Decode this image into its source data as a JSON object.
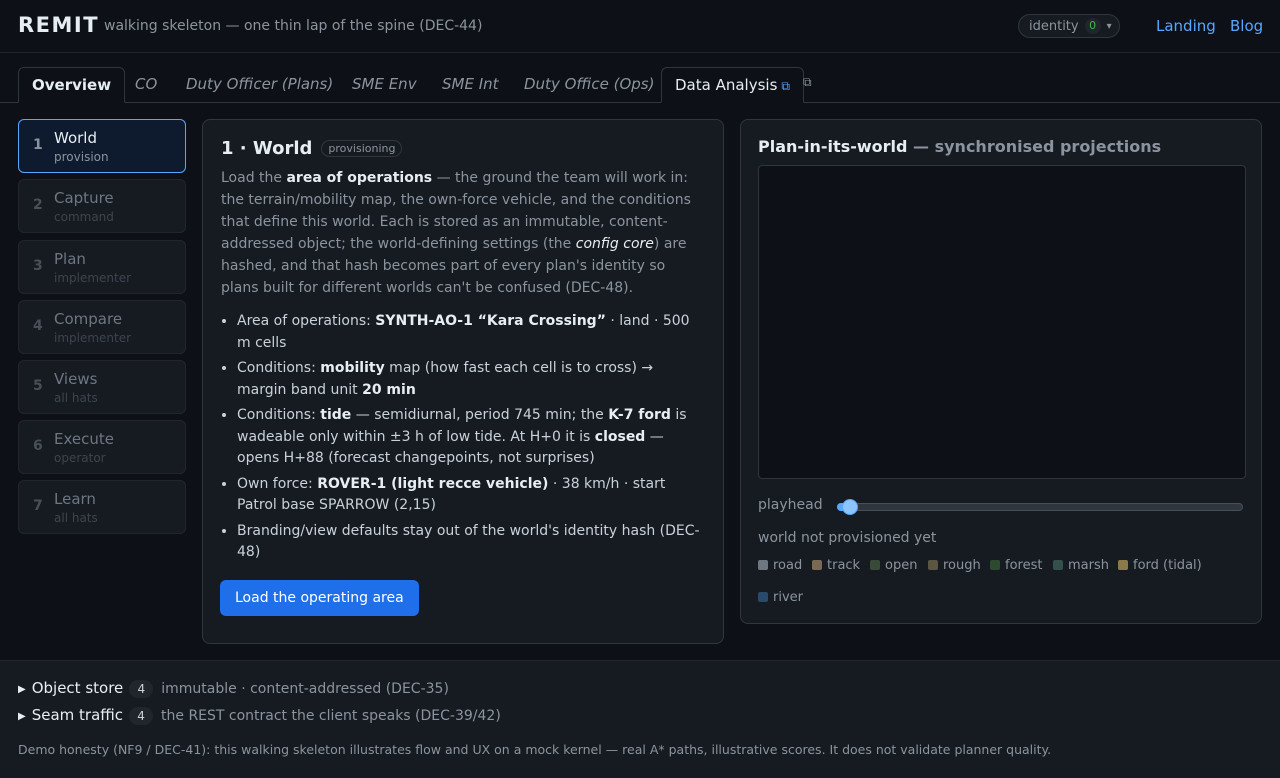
{
  "header": {
    "brand": "REMIT",
    "tagline": "walking skeleton — one thin lap of the spine (DEC-44)",
    "identity_label": "identity",
    "identity_count": "0",
    "links": [
      "Landing",
      "Blog"
    ]
  },
  "tabs": [
    "Overview",
    "CO",
    "Duty Officer (Plans)",
    "SME Env",
    "SME Int",
    "Duty Office (Ops)",
    "Data Analysis"
  ],
  "steps": [
    {
      "num": "1",
      "title": "World",
      "sub": "provision"
    },
    {
      "num": "2",
      "title": "Capture",
      "sub": "command"
    },
    {
      "num": "3",
      "title": "Plan",
      "sub": "implementer"
    },
    {
      "num": "4",
      "title": "Compare",
      "sub": "implementer"
    },
    {
      "num": "5",
      "title": "Views",
      "sub": "all hats"
    },
    {
      "num": "6",
      "title": "Execute",
      "sub": "operator"
    },
    {
      "num": "7",
      "title": "Learn",
      "sub": "all hats"
    }
  ],
  "card": {
    "title": "1 · World",
    "badge": "provisioning",
    "intro": {
      "p1": "Load the ",
      "b1": "area of operations",
      "p2": " — the ground the team will work in: the terrain/mobility map, the own-force vehicle, and the conditions that define this world. Each is stored as an immutable, content-addressed object; the world-defining settings (the ",
      "i1": "config core",
      "p3": ") are hashed, and that hash becomes part of every plan's identity so plans built for different worlds can't be confused (DEC-48)."
    },
    "facts": {
      "f1a": "Area of operations: ",
      "f1b": "SYNTH-AO-1 “Kara Crossing”",
      "f1c": " · land · 500 m cells",
      "f2a": "Conditions: ",
      "f2b": "mobility",
      "f2c": " map (how fast each cell is to cross) → margin band unit ",
      "f2d": "20 min",
      "f3a": "Conditions: ",
      "f3b": "tide",
      "f3c": " — semidiurnal, period 745 min; the ",
      "f3d": "K-7 ford",
      "f3e": " is wadeable only within ±3 h of low tide. At H+0 it is ",
      "f3f": "closed",
      "f3g": " — opens H+88 (forecast changepoints, not surprises)",
      "f4a": "Own force: ",
      "f4b": "ROVER-1 (light recce vehicle)",
      "f4c": " · 38 km/h · start Patrol base SPARROW (2,15)",
      "f5": "Branding/view defaults stay out of the world's identity hash (DEC-48)"
    },
    "button": "Load the operating area"
  },
  "panel": {
    "title": "Plan-in-its-world",
    "subtitle": " — synchronised projections",
    "playhead_label": "playhead",
    "playhead_position": 0.0,
    "status": "world not provisioned yet",
    "legend": [
      {
        "label": "road",
        "color": "#6e7681"
      },
      {
        "label": "track",
        "color": "#7a6a55"
      },
      {
        "label": "open",
        "color": "#3a4a38"
      },
      {
        "label": "rough",
        "color": "#5a5640"
      },
      {
        "label": "forest",
        "color": "#2c4a30"
      },
      {
        "label": "marsh",
        "color": "#34504a"
      },
      {
        "label": "ford (tidal)",
        "color": "#8a7a4a"
      },
      {
        "label": "river",
        "color": "#2a4a6a"
      }
    ]
  },
  "footer": {
    "object_store": {
      "label": "Object store",
      "count": "4",
      "desc": "immutable · content-addressed (DEC-35)"
    },
    "seam_traffic": {
      "label": "Seam traffic",
      "count": "4",
      "desc": "the REST contract the client speaks (DEC-39/42)"
    },
    "honesty": "Demo honesty (NF9 / DEC-41): this walking skeleton illustrates flow and UX on a mock kernel — real A* paths, illustrative scores. It does not validate planner quality."
  }
}
